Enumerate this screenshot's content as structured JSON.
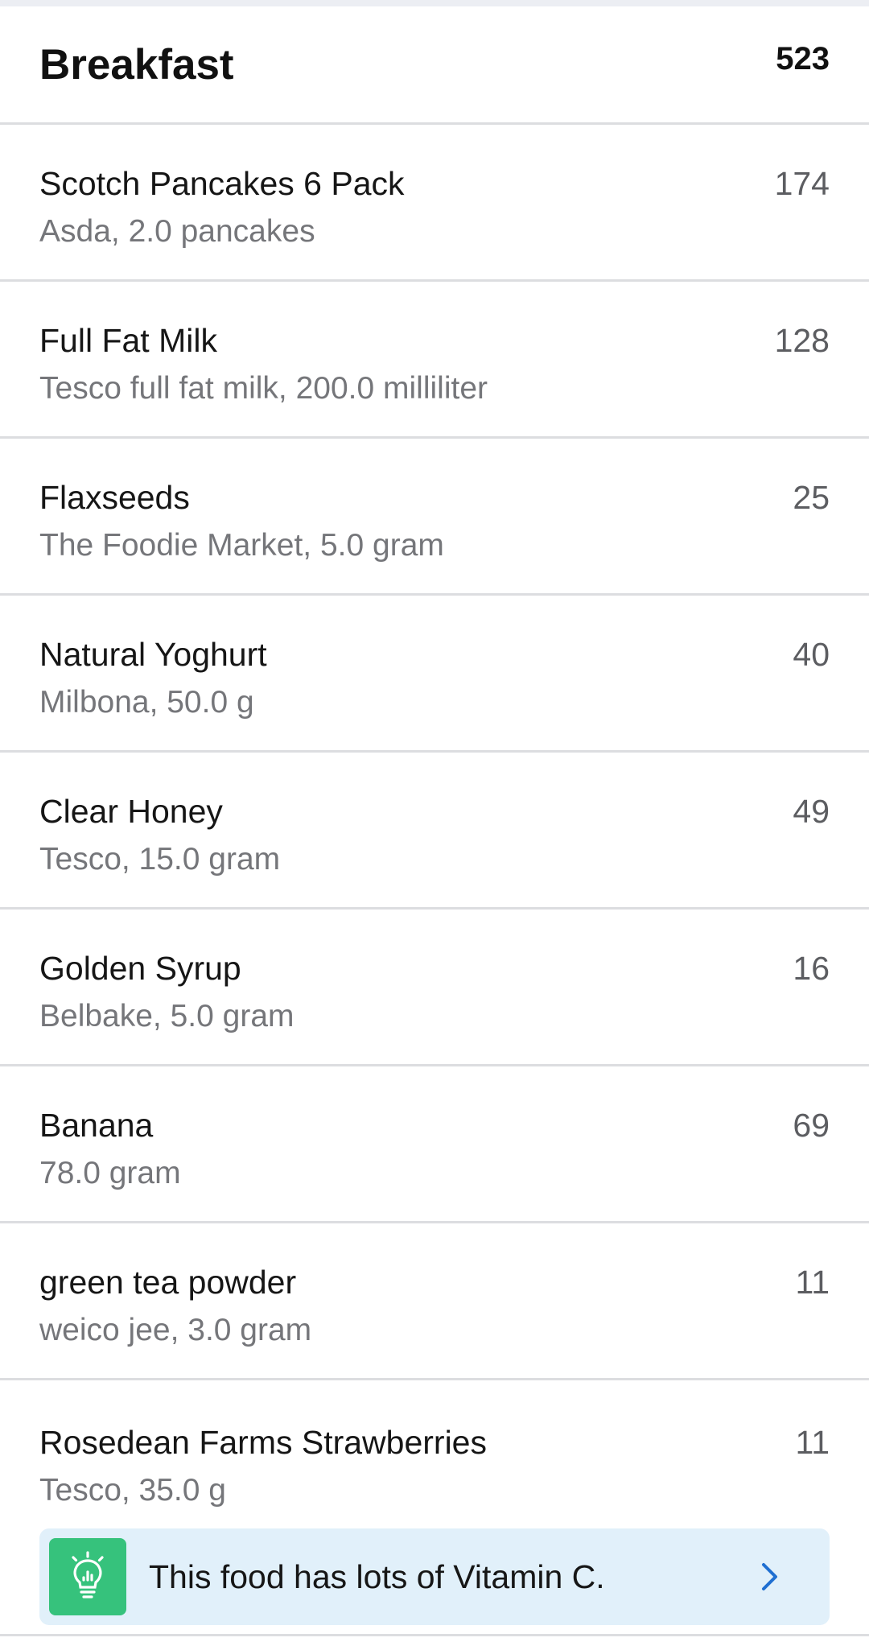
{
  "meal": {
    "title": "Breakfast",
    "total_calories": "523"
  },
  "foods": [
    {
      "name": "Scotch Pancakes 6 Pack",
      "detail": "Asda, 2.0 pancakes",
      "calories": "174"
    },
    {
      "name": "Full Fat Milk",
      "detail": "Tesco full fat milk, 200.0 milliliter",
      "calories": "128"
    },
    {
      "name": "Flaxseeds",
      "detail": "The Foodie Market, 5.0 gram",
      "calories": "25"
    },
    {
      "name": "Natural Yoghurt",
      "detail": "Milbona, 50.0 g",
      "calories": "40"
    },
    {
      "name": "Clear Honey",
      "detail": "Tesco, 15.0 gram",
      "calories": "49"
    },
    {
      "name": "Golden Syrup",
      "detail": "Belbake, 5.0 gram",
      "calories": "16"
    },
    {
      "name": "Banana",
      "detail": "78.0 gram",
      "calories": "69"
    },
    {
      "name": "green tea powder",
      "detail": "weico jee, 3.0 gram",
      "calories": "11"
    },
    {
      "name": "Rosedean Farms Strawberries",
      "detail": "Tesco, 35.0 g",
      "calories": "11"
    }
  ],
  "insight": {
    "text": "This food has lots of Vitamin C.",
    "icon": "lightbulb-chart-icon",
    "icon_bg_color": "#36c27c",
    "banner_bg_color": "#e1f0fa",
    "chevron_color": "#1f6fd1"
  }
}
